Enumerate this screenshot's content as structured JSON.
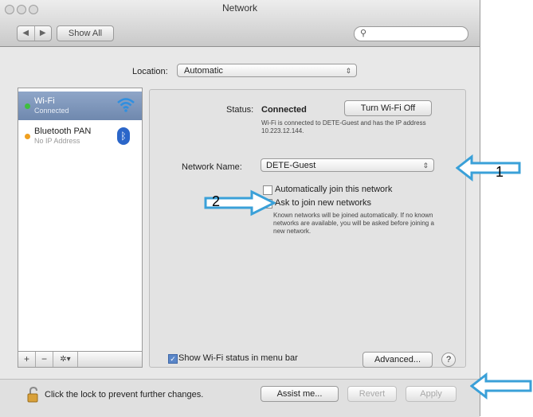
{
  "window": {
    "title": "Network"
  },
  "toolbar": {
    "back": "◀",
    "forward": "▶",
    "show_all": "Show All",
    "search_placeholder": ""
  },
  "location": {
    "label": "Location:",
    "value": "Automatic"
  },
  "sidebar": {
    "items": [
      {
        "name": "Wi-Fi",
        "status": "Connected",
        "dot_color": "#3fbf3f",
        "icon": "wifi-icon"
      },
      {
        "name": "Bluetooth PAN",
        "status": "No IP Address",
        "dot_color": "#f0a020",
        "icon": "bluetooth-icon"
      }
    ],
    "tools": {
      "add": "+",
      "remove": "−",
      "gear": "✲▾"
    }
  },
  "detail": {
    "status_label": "Status:",
    "status_value": "Connected",
    "turn_off_label": "Turn Wi-Fi Off",
    "status_description": "Wi-Fi is connected to DETE-Guest and has the IP address 10.223.12.144.",
    "network_name_label": "Network Name:",
    "network_name_value": "DETE-Guest",
    "auto_join_label": "Automatically join this network",
    "ask_join_label": "Ask to join new networks",
    "ask_join_help": "Known networks will be joined automatically. If no known networks are available, you will be asked before joining a new network.",
    "show_status_label": "Show Wi-Fi status in menu bar",
    "advanced_label": "Advanced...",
    "help_label": "?"
  },
  "bottom": {
    "lock_text": "Click the lock to prevent further changes.",
    "assist_label": "Assist me...",
    "revert_label": "Revert",
    "apply_label": "Apply"
  },
  "annotations": {
    "one": "1",
    "two": "2"
  },
  "colors": {
    "arrow_fill": "#ffffff",
    "arrow_stroke": "#3aa0d8",
    "selection": "#7b93b8"
  }
}
